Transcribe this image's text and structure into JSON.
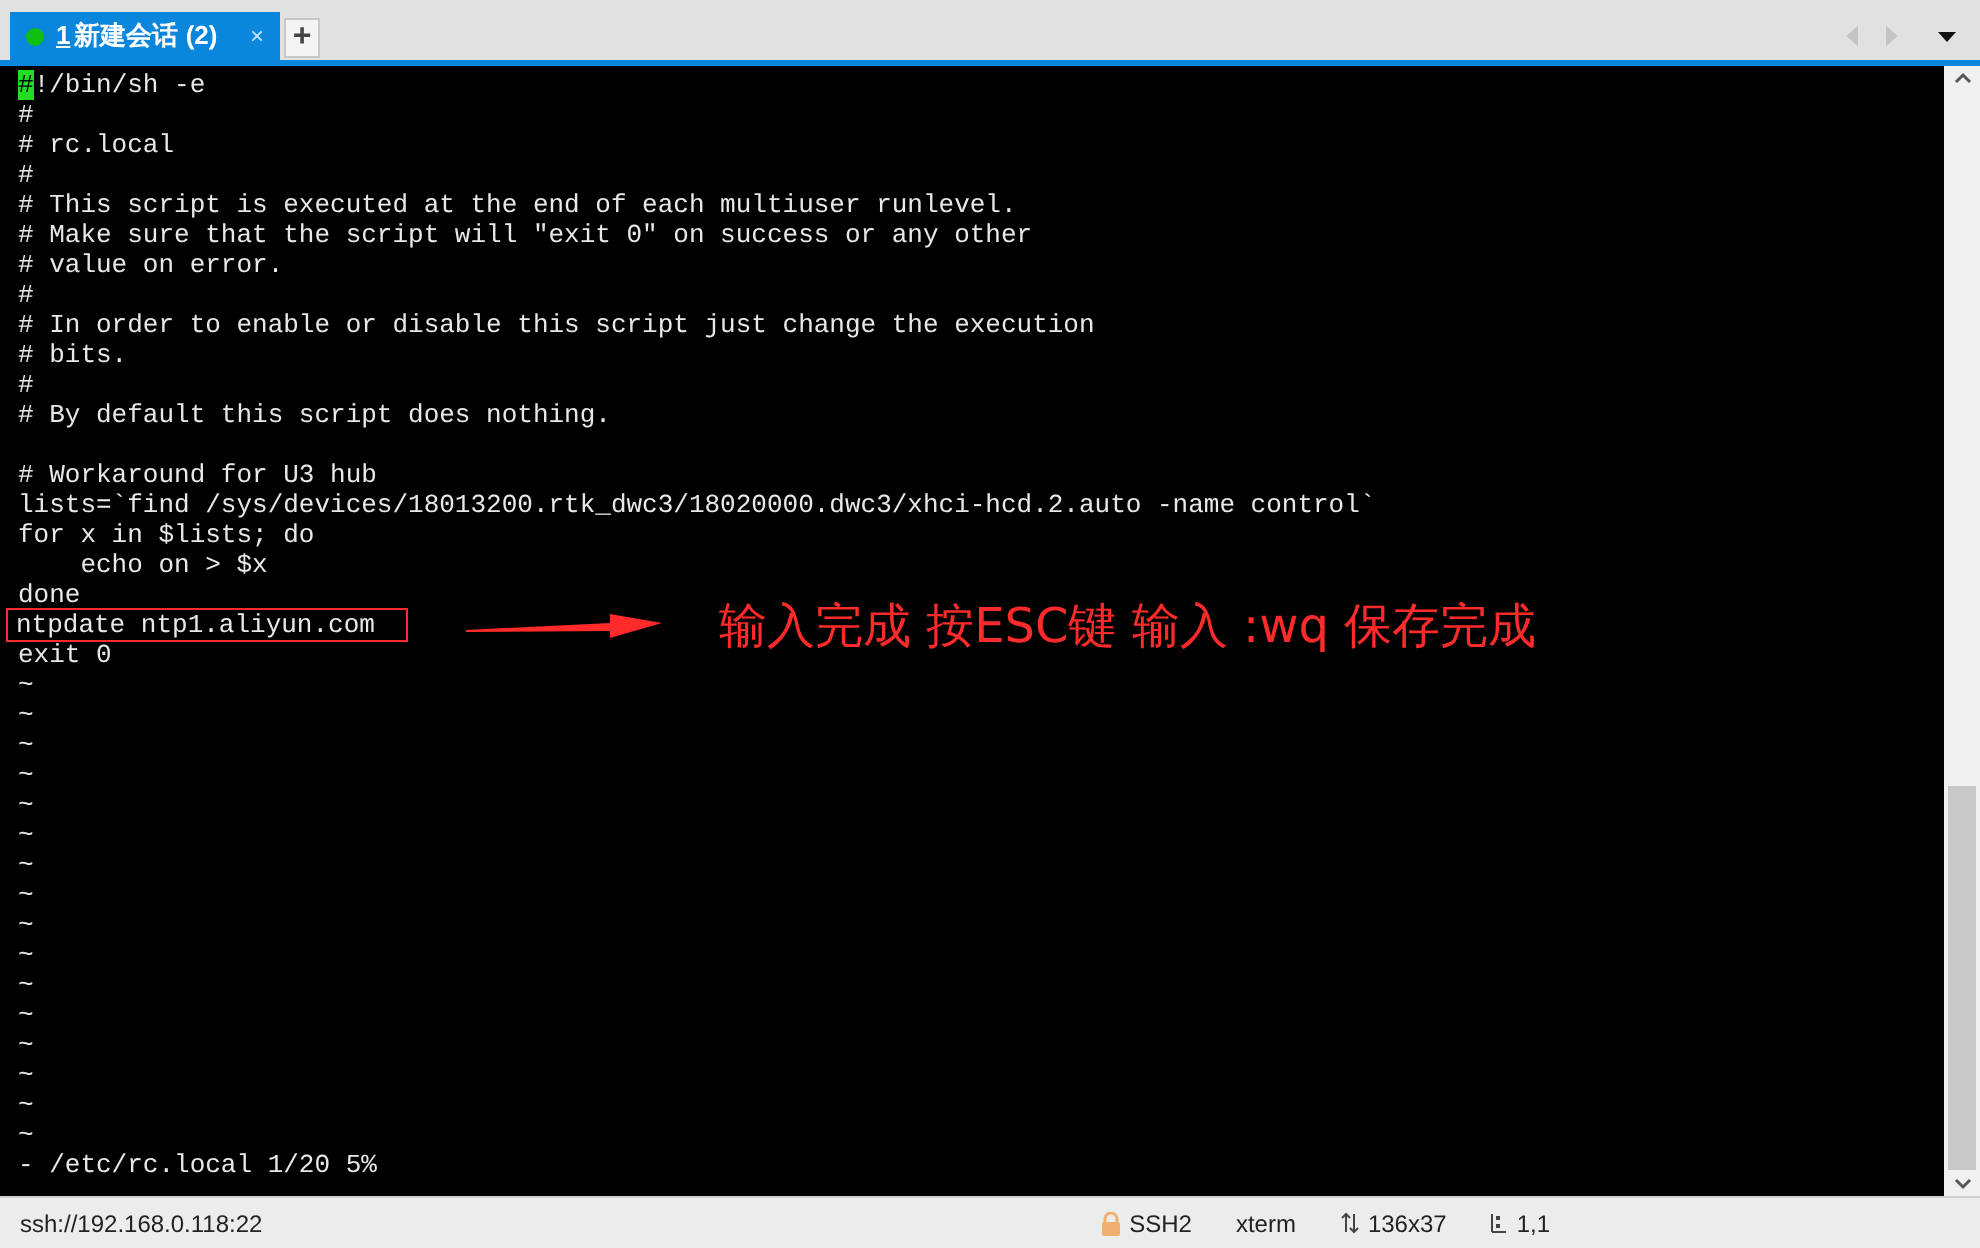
{
  "tabs": [
    {
      "number": "1",
      "label": "新建会话 (2)",
      "selected": true,
      "connected": true,
      "close": "×"
    }
  ],
  "new_tab": "+",
  "terminal": {
    "lines": [
      {
        "kind": "code",
        "text": "#!/bin/sh -e",
        "cursor": true
      },
      {
        "kind": "code",
        "text": "#"
      },
      {
        "kind": "code",
        "text": "# rc.local"
      },
      {
        "kind": "code",
        "text": "#"
      },
      {
        "kind": "code",
        "text": "# This script is executed at the end of each multiuser runlevel."
      },
      {
        "kind": "code",
        "text": "# Make sure that the script will \"exit 0\" on success or any other"
      },
      {
        "kind": "code",
        "text": "# value on error."
      },
      {
        "kind": "code",
        "text": "#"
      },
      {
        "kind": "code",
        "text": "# In order to enable or disable this script just change the execution"
      },
      {
        "kind": "code",
        "text": "# bits."
      },
      {
        "kind": "code",
        "text": "#"
      },
      {
        "kind": "code",
        "text": "# By default this script does nothing."
      },
      {
        "kind": "blank"
      },
      {
        "kind": "code",
        "text": "# Workaround for U3 hub"
      },
      {
        "kind": "code",
        "text": "lists=`find /sys/devices/18013200.rtk_dwc3/18020000.dwc3/xhci-hcd.2.auto -name control`"
      },
      {
        "kind": "code",
        "text": "for x in $lists; do"
      },
      {
        "kind": "code",
        "text": "    echo on > $x"
      },
      {
        "kind": "code",
        "text": "done"
      },
      {
        "kind": "code",
        "text": "ntpdate ntp1.aliyun.com",
        "highlighted": true
      },
      {
        "kind": "code",
        "text": "exit 0"
      },
      {
        "kind": "code",
        "text": "~"
      },
      {
        "kind": "code",
        "text": "~"
      },
      {
        "kind": "code",
        "text": "~"
      },
      {
        "kind": "code",
        "text": "~"
      },
      {
        "kind": "code",
        "text": "~"
      },
      {
        "kind": "code",
        "text": "~"
      },
      {
        "kind": "code",
        "text": "~"
      },
      {
        "kind": "code",
        "text": "~"
      },
      {
        "kind": "code",
        "text": "~"
      },
      {
        "kind": "code",
        "text": "~"
      },
      {
        "kind": "code",
        "text": "~"
      },
      {
        "kind": "code",
        "text": "~"
      },
      {
        "kind": "code",
        "text": "~"
      },
      {
        "kind": "code",
        "text": "~"
      },
      {
        "kind": "code",
        "text": "~"
      },
      {
        "kind": "code",
        "text": "~"
      },
      {
        "kind": "code",
        "text": "- /etc/rc.local 1/20 5%"
      }
    ],
    "annotation": "输入完成 按ESC键 输入 :wq 保存完成"
  },
  "status_bar": {
    "address": "ssh://192.168.0.118:22",
    "items": [
      {
        "kind": "lock",
        "text": "SSH2"
      },
      {
        "kind": "plain",
        "text": "xterm"
      },
      {
        "kind": "size",
        "text": "136x37"
      },
      {
        "kind": "cursor",
        "text": "1,1"
      }
    ]
  }
}
